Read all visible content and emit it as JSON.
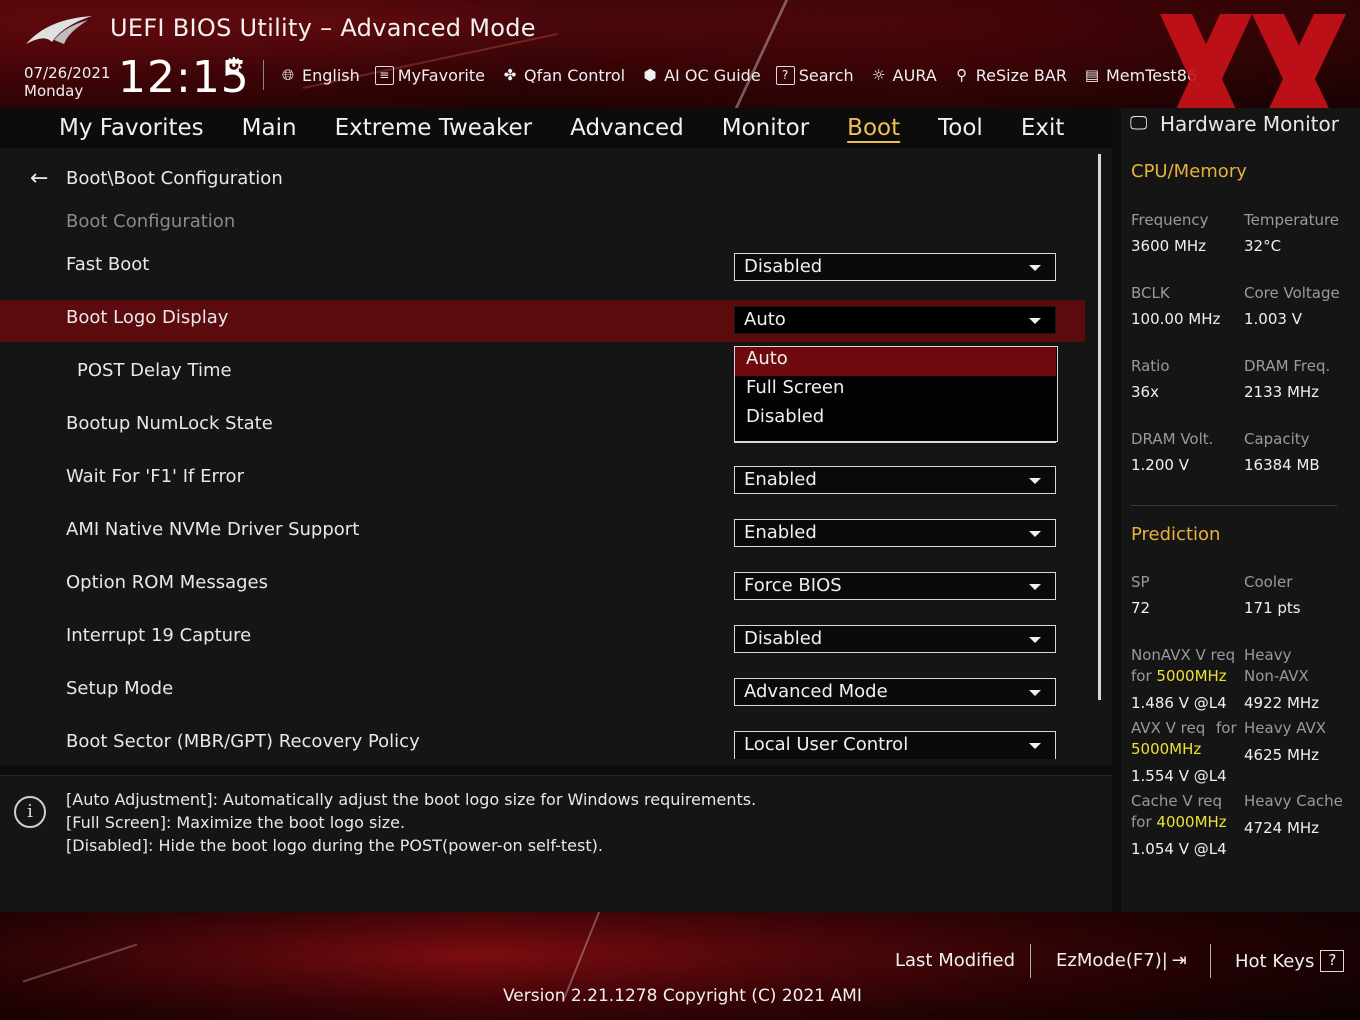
{
  "header": {
    "title": "UEFI BIOS Utility – Advanced Mode",
    "date": "07/26/2021",
    "day": "Monday",
    "time": "12:15",
    "toolbar": [
      {
        "label": "English",
        "icon": "globe-icon"
      },
      {
        "label": "MyFavorite",
        "icon": "favorite-icon"
      },
      {
        "label": "Qfan Control",
        "icon": "fan-icon"
      },
      {
        "label": "AI OC Guide",
        "icon": "ai-icon"
      },
      {
        "label": "Search",
        "icon": "search-icon"
      },
      {
        "label": "AURA",
        "icon": "aura-icon"
      },
      {
        "label": "ReSize BAR",
        "icon": "resize-bar-icon"
      },
      {
        "label": "MemTest86",
        "icon": "memtest-icon"
      }
    ]
  },
  "tabs": [
    {
      "label": "My Favorites"
    },
    {
      "label": "Main"
    },
    {
      "label": "Extreme Tweaker"
    },
    {
      "label": "Advanced"
    },
    {
      "label": "Monitor"
    },
    {
      "label": "Boot",
      "active": true
    },
    {
      "label": "Tool"
    },
    {
      "label": "Exit"
    }
  ],
  "main": {
    "breadcrumb": "Boot\\Boot Configuration",
    "section_title": "Boot Configuration",
    "settings": [
      {
        "label": "Fast Boot",
        "value": "Disabled"
      },
      {
        "label": "Boot Logo Display",
        "value": "Auto"
      },
      {
        "label": "POST Delay Time",
        "value": ""
      },
      {
        "label": "Bootup NumLock State",
        "value": ""
      },
      {
        "label": "Wait For 'F1' If Error",
        "value": "Enabled"
      },
      {
        "label": "AMI Native NVMe Driver Support",
        "value": "Enabled"
      },
      {
        "label": "Option ROM Messages",
        "value": "Force BIOS"
      },
      {
        "label": "Interrupt 19 Capture",
        "value": "Disabled"
      },
      {
        "label": "Setup Mode",
        "value": "Advanced Mode"
      },
      {
        "label": "Boot Sector (MBR/GPT) Recovery Policy",
        "value": "Local User Control"
      }
    ],
    "dropdown_options": [
      "Auto",
      "Full Screen",
      "Disabled"
    ],
    "dropdown_selected": "Auto"
  },
  "info": {
    "lines": [
      "[Auto Adjustment]: Automatically adjust the boot logo size for Windows requirements.",
      "[Full Screen]: Maximize the boot logo size.",
      "[Disabled]: Hide the boot logo during the POST(power-on self-test)."
    ]
  },
  "hw_monitor": {
    "title": "Hardware Monitor",
    "cpu_memory": {
      "heading": "CPU/Memory",
      "items": [
        {
          "label": "Frequency",
          "value": "3600 MHz"
        },
        {
          "label": "Temperature",
          "value": "32°C"
        },
        {
          "label": "BCLK",
          "value": "100.00 MHz"
        },
        {
          "label": "Core Voltage",
          "value": "1.003 V"
        },
        {
          "label": "Ratio",
          "value": "36x"
        },
        {
          "label": "DRAM Freq.",
          "value": "2133 MHz"
        },
        {
          "label": "DRAM Volt.",
          "value": "1.200 V"
        },
        {
          "label": "Capacity",
          "value": "16384 MB"
        }
      ]
    },
    "prediction": {
      "heading": "Prediction",
      "sp_label": "SP",
      "sp_value": "72",
      "cooler_label": "Cooler",
      "cooler_value": "171 pts",
      "nonavx_label_1": "NonAVX V req",
      "nonavx_for": "for",
      "nonavx_freq": "5000MHz",
      "nonavx_value": "1.486 V @L4",
      "heavy_nonavx_label_1": "Heavy",
      "heavy_nonavx_label_2": "Non-AVX",
      "heavy_nonavx_value": "4922 MHz",
      "avx_label_1": "AVX V req",
      "avx_for": "for",
      "avx_freq": "5000MHz",
      "avx_value": "1.554 V @L4",
      "heavy_avx_label": "Heavy AVX",
      "heavy_avx_value": "4625 MHz",
      "cache_label_1": "Cache V req",
      "cache_for": "for",
      "cache_freq": "4000MHz",
      "cache_value": "1.054 V @L4",
      "heavy_cache_label": "Heavy Cache",
      "heavy_cache_value": "4724 MHz"
    }
  },
  "footer": {
    "last_modified": "Last Modified",
    "ezmode": "EzMode(F7)|",
    "hot_keys": "Hot Keys",
    "hot_keys_icon": "?",
    "version": "Version 2.21.1278 Copyright (C) 2021 AMI"
  },
  "colors": {
    "accent": "#e8b13a",
    "highlight_row": "#5b0a0d",
    "freq_highlight": "#f0e030"
  }
}
